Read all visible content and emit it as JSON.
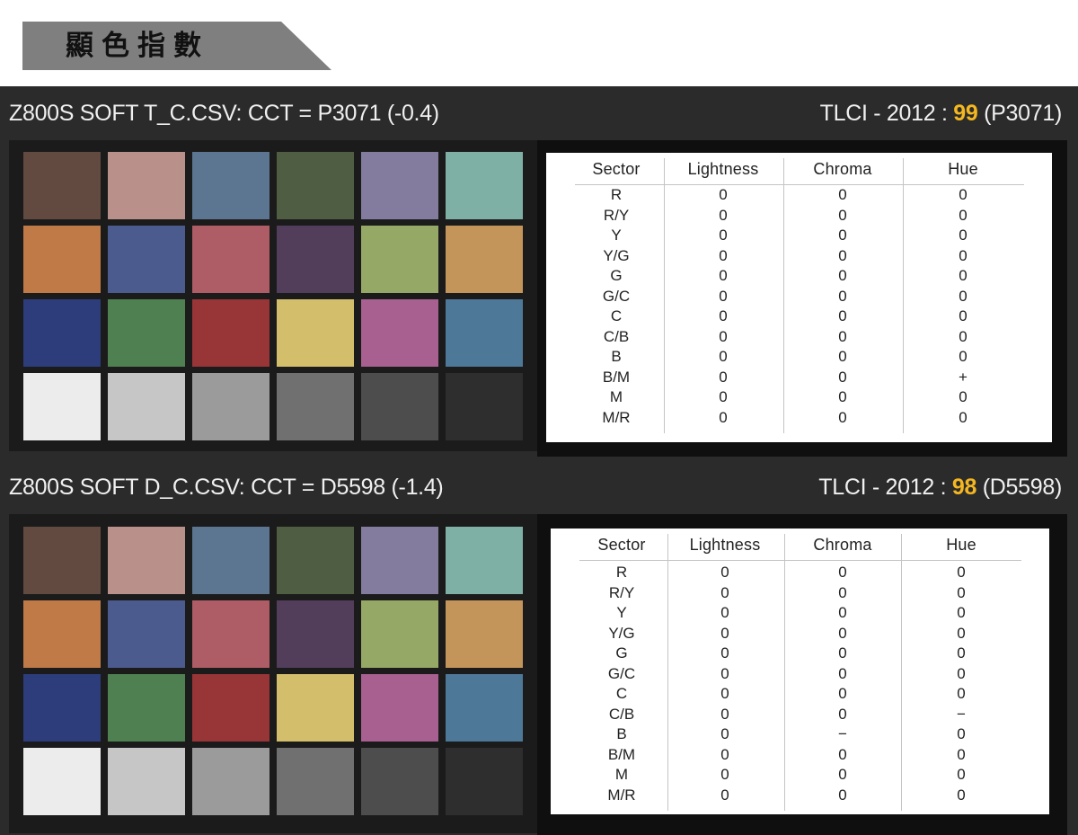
{
  "header": {
    "title": "顯色指數"
  },
  "colors": {
    "banner": "#7f7f7f",
    "panel": "#2b2b2b",
    "score": "#f5b721"
  },
  "sections": [
    {
      "title": "Z800S SOFT T_C.CSV: CCT = P3071 (-0.4)",
      "tlci_label": "TLCI - 2012 : ",
      "tlci_score": "99",
      "tlci_ref": " (P3071)",
      "table": {
        "headers": [
          "Sector",
          "Lightness",
          "Chroma",
          "Hue"
        ],
        "rows": [
          [
            "R",
            "0",
            "0",
            "0"
          ],
          [
            "R/Y",
            "0",
            "0",
            "0"
          ],
          [
            "Y",
            "0",
            "0",
            "0"
          ],
          [
            "Y/G",
            "0",
            "0",
            "0"
          ],
          [
            "G",
            "0",
            "0",
            "0"
          ],
          [
            "G/C",
            "0",
            "0",
            "0"
          ],
          [
            "C",
            "0",
            "0",
            "0"
          ],
          [
            "C/B",
            "0",
            "0",
            "0"
          ],
          [
            "B",
            "0",
            "0",
            "0"
          ],
          [
            "B/M",
            "0",
            "0",
            "+"
          ],
          [
            "M",
            "0",
            "0",
            "0"
          ],
          [
            "M/R",
            "0",
            "0",
            "0"
          ]
        ]
      }
    },
    {
      "title": "Z800S SOFT D_C.CSV: CCT = D5598 (-1.4)",
      "tlci_label": "TLCI - 2012 : ",
      "tlci_score": "98",
      "tlci_ref": " (D5598)",
      "table": {
        "headers": [
          "Sector",
          "Lightness",
          "Chroma",
          "Hue"
        ],
        "rows": [
          [
            "R",
            "0",
            "0",
            "0"
          ],
          [
            "R/Y",
            "0",
            "0",
            "0"
          ],
          [
            "Y",
            "0",
            "0",
            "0"
          ],
          [
            "Y/G",
            "0",
            "0",
            "0"
          ],
          [
            "G",
            "0",
            "0",
            "0"
          ],
          [
            "G/C",
            "0",
            "0",
            "0"
          ],
          [
            "C",
            "0",
            "0",
            "0"
          ],
          [
            "C/B",
            "0",
            "0",
            "−"
          ],
          [
            "B",
            "0",
            "−",
            "0"
          ],
          [
            "B/M",
            "0",
            "0",
            "0"
          ],
          [
            "M",
            "0",
            "0",
            "0"
          ],
          [
            "M/R",
            "0",
            "0",
            "0"
          ]
        ]
      }
    }
  ],
  "chart_data": [
    {
      "type": "table",
      "title": "Z800S SOFT T_C.CSV: CCT = P3071 (-0.4)",
      "tlci_2012": 99,
      "columns": [
        "Sector",
        "Lightness",
        "Chroma",
        "Hue"
      ],
      "rows": [
        [
          "R",
          "0",
          "0",
          "0"
        ],
        [
          "R/Y",
          "0",
          "0",
          "0"
        ],
        [
          "Y",
          "0",
          "0",
          "0"
        ],
        [
          "Y/G",
          "0",
          "0",
          "0"
        ],
        [
          "G",
          "0",
          "0",
          "0"
        ],
        [
          "G/C",
          "0",
          "0",
          "0"
        ],
        [
          "C",
          "0",
          "0",
          "0"
        ],
        [
          "C/B",
          "0",
          "0",
          "0"
        ],
        [
          "B",
          "0",
          "0",
          "0"
        ],
        [
          "B/M",
          "0",
          "0",
          "+"
        ],
        [
          "M",
          "0",
          "0",
          "0"
        ],
        [
          "M/R",
          "0",
          "0",
          "0"
        ]
      ],
      "patch_colors": [
        "#634a40",
        "#ba908a",
        "#5c7590",
        "#4f5e42",
        "#837c9f",
        "#7fb0a6",
        "#c07a48",
        "#4c5b8e",
        "#ae5c65",
        "#523d5b",
        "#95a865",
        "#c4955a",
        "#2d3d7b",
        "#4f8052",
        "#983537",
        "#d3be6c",
        "#a86090",
        "#4e7898",
        "#ececec",
        "#c6c6c6",
        "#9b9b9b",
        "#707070",
        "#4d4d4d",
        "#2e2e2e"
      ]
    },
    {
      "type": "table",
      "title": "Z800S SOFT D_C.CSV: CCT = D5598 (-1.4)",
      "tlci_2012": 98,
      "columns": [
        "Sector",
        "Lightness",
        "Chroma",
        "Hue"
      ],
      "rows": [
        [
          "R",
          "0",
          "0",
          "0"
        ],
        [
          "R/Y",
          "0",
          "0",
          "0"
        ],
        [
          "Y",
          "0",
          "0",
          "0"
        ],
        [
          "Y/G",
          "0",
          "0",
          "0"
        ],
        [
          "G",
          "0",
          "0",
          "0"
        ],
        [
          "G/C",
          "0",
          "0",
          "0"
        ],
        [
          "C",
          "0",
          "0",
          "0"
        ],
        [
          "C/B",
          "0",
          "0",
          "−"
        ],
        [
          "B",
          "0",
          "−",
          "0"
        ],
        [
          "B/M",
          "0",
          "0",
          "0"
        ],
        [
          "M",
          "0",
          "0",
          "0"
        ],
        [
          "M/R",
          "0",
          "0",
          "0"
        ]
      ],
      "patch_colors": [
        "#634a40",
        "#ba908a",
        "#5c7590",
        "#4f5e42",
        "#837c9f",
        "#7fb0a6",
        "#c07a48",
        "#4c5b8e",
        "#ae5c65",
        "#523d5b",
        "#95a865",
        "#c4955a",
        "#2d3d7b",
        "#4f8052",
        "#983537",
        "#d3be6c",
        "#a86090",
        "#4e7898",
        "#ececec",
        "#c6c6c6",
        "#9b9b9b",
        "#707070",
        "#4d4d4d",
        "#2e2e2e"
      ]
    }
  ]
}
